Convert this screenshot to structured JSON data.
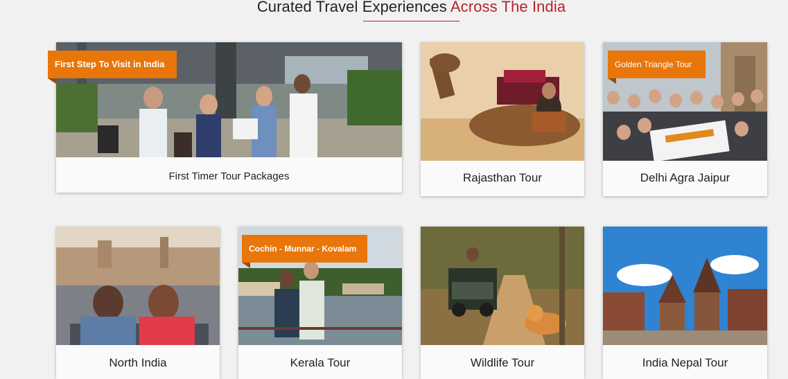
{
  "section": {
    "heading_main": "Curated Travel Experiences",
    "heading_accent": "Across The India"
  },
  "colors": {
    "accent": "#b7232a",
    "tag_bg": "#e8760a",
    "page_bg": "#f1f1f1"
  },
  "cards": [
    {
      "title": "First Timer Tour Packages",
      "tag": "First Step To Visit in India"
    },
    {
      "title": "Rajasthan Tour"
    },
    {
      "title": "Delhi Agra Jaipur",
      "tag": "Golden Triangle Tour"
    },
    {
      "title": "North India"
    },
    {
      "title": "Kerala Tour",
      "tag": "Cochin - Munnar - Kovalam"
    },
    {
      "title": "Wildlife Tour"
    },
    {
      "title": "India Nepal Tour"
    }
  ]
}
